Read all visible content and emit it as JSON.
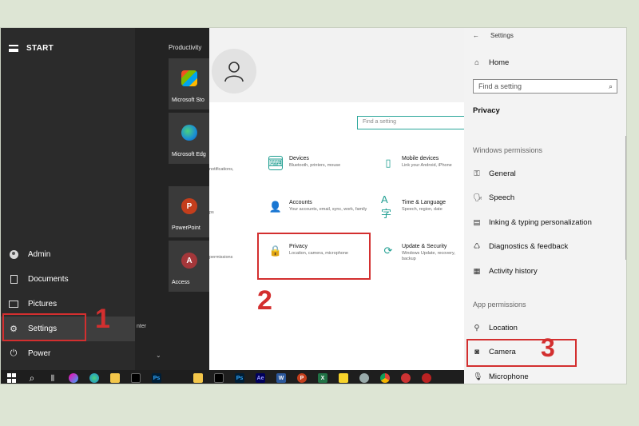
{
  "start_menu": {
    "title": "START",
    "items": [
      {
        "label": "Admin",
        "icon": "user-icon"
      },
      {
        "label": "Documents",
        "icon": "document-icon"
      },
      {
        "label": "Pictures",
        "icon": "pictures-icon"
      },
      {
        "label": "Settings",
        "icon": "gear-icon"
      },
      {
        "label": "Power",
        "icon": "power-icon"
      }
    ]
  },
  "tiles": {
    "group_label": "Productivity",
    "items": [
      {
        "label": "Microsoft Sto",
        "icon": "store-icon"
      },
      {
        "label": "Microsoft Edg",
        "icon": "edge-icon"
      },
      {
        "label": "PowerPoint",
        "icon": "powerpoint-icon",
        "letter": "P"
      },
      {
        "label": "Access",
        "icon": "access-icon",
        "letter": "A"
      }
    ],
    "cut_texts": [
      "notifications,",
      "ps",
      "permissions",
      "nter"
    ]
  },
  "settings_home": {
    "search_placeholder": "Find a setting",
    "categories": [
      {
        "title": "Devices",
        "desc": "Bluetooth, printers, mouse",
        "icon": "devices-icon"
      },
      {
        "title": "Mobile devices",
        "desc": "Link your Android, iPhone",
        "icon": "phone-icon"
      },
      {
        "title": "Accounts",
        "desc": "Your accounts, email, sync, work, family",
        "icon": "accounts-icon"
      },
      {
        "title": "Time & Language",
        "desc": "Speech, region, date",
        "icon": "time-language-icon"
      },
      {
        "title": "Privacy",
        "desc": "Location, camera, microphone",
        "icon": "lock-icon"
      },
      {
        "title": "Update & Security",
        "desc": "Windows Update, recovery, backup",
        "icon": "update-icon"
      }
    ]
  },
  "settings_pane": {
    "title": "Settings",
    "home_label": "Home",
    "search_placeholder": "Find a setting",
    "section": "Privacy",
    "windows_permissions_label": "Windows permissions",
    "windows_permissions": [
      {
        "label": "General",
        "icon": "lock-icon"
      },
      {
        "label": "Speech",
        "icon": "speech-icon"
      },
      {
        "label": "Inking & typing personalization",
        "icon": "inking-icon"
      },
      {
        "label": "Diagnostics & feedback",
        "icon": "diagnostics-icon"
      },
      {
        "label": "Activity history",
        "icon": "activity-icon"
      }
    ],
    "app_permissions_label": "App permissions",
    "app_permissions": [
      {
        "label": "Location",
        "icon": "location-icon"
      },
      {
        "label": "Camera",
        "icon": "camera-icon"
      },
      {
        "label": "Microphone",
        "icon": "microphone-icon"
      }
    ]
  },
  "annotations": {
    "step1": "1",
    "step2": "2",
    "step3": "3",
    "color": "#d32f2f"
  },
  "taskbar": {
    "icons": [
      "windows-icon",
      "search-icon",
      "task-view-icon",
      "copilot-icon",
      "edge-icon",
      "explorer-icon",
      "terminal-icon",
      "photoshop-icon",
      "app-icon",
      "explorer-icon",
      "app-icon",
      "photoshop-icon",
      "after-effects-icon",
      "word-icon",
      "powerpoint-icon",
      "excel-icon",
      "sticky-notes-icon",
      "app-icon",
      "chrome-icon",
      "app-icon",
      "app-icon"
    ],
    "ps_label": "Ps",
    "ae_label": "Ae",
    "w_label": "W",
    "p_label": "P",
    "x_label": "X"
  }
}
